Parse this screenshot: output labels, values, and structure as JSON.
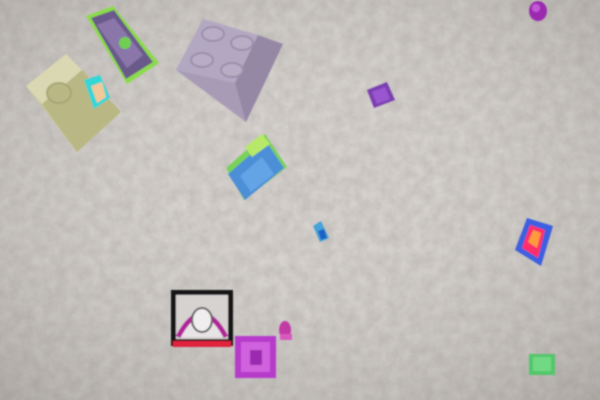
{
  "scene": {
    "description_visible_text": "",
    "background": {
      "kind": "carpet",
      "color": "#bdb8b3"
    },
    "objects": [
      {
        "kind": "brick",
        "color": "#7d6a9c",
        "accent": "#8adb4a"
      },
      {
        "kind": "brick",
        "color": "#c8c596"
      },
      {
        "kind": "brick",
        "color": "#a79bb6"
      },
      {
        "kind": "piece",
        "color": "#7a3fb0"
      },
      {
        "kind": "piece",
        "color": "#9b2bb0"
      },
      {
        "kind": "brick",
        "color": "#4d8fd6",
        "accent": "#79d15a"
      },
      {
        "kind": "piece",
        "color": "#46a2d7"
      },
      {
        "kind": "piece",
        "color": "#3d5fe0",
        "accent": "#ff2f6b"
      },
      {
        "kind": "brick",
        "color": "#d6d2d0",
        "accent": "#b2239a"
      },
      {
        "kind": "piece",
        "color": "#b63acb"
      },
      {
        "kind": "piece",
        "color": "#c23aa5"
      },
      {
        "kind": "piece",
        "color": "#52c66a"
      }
    ]
  }
}
